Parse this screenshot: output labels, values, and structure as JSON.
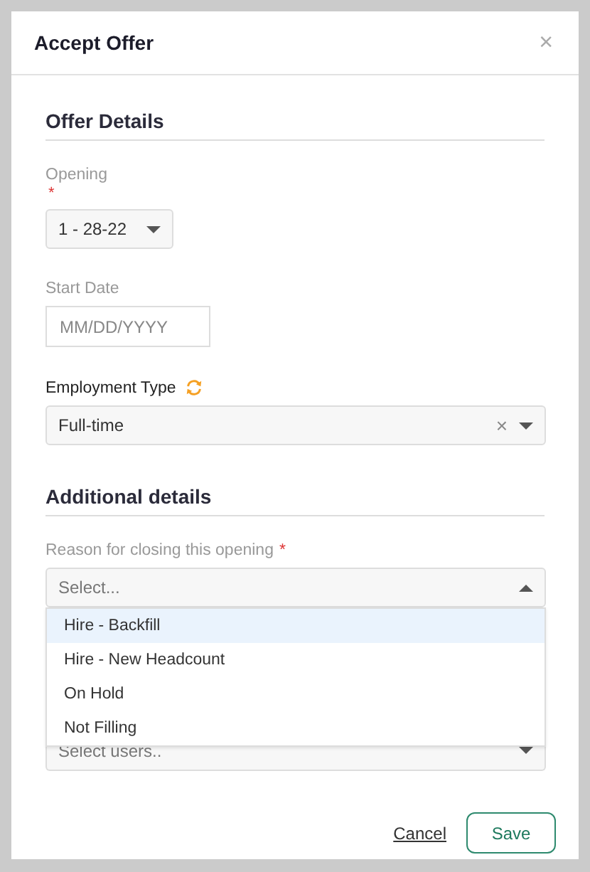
{
  "dialog": {
    "title": "Accept Offer",
    "close": "×"
  },
  "offer_details": {
    "heading": "Offer Details",
    "opening": {
      "label": "Opening",
      "required_mark": "*",
      "value": "1 - 28-22"
    },
    "start_date": {
      "label": "Start Date",
      "placeholder": "MM/DD/YYYY"
    },
    "employment_type": {
      "label": "Employment Type",
      "value": "Full-time",
      "clear": "×"
    }
  },
  "additional_details": {
    "heading": "Additional details",
    "reason": {
      "label": "Reason for closing this opening",
      "required_mark": "*",
      "placeholder": "Select...",
      "expanded": true,
      "options": [
        {
          "label": "Hire - Backfill",
          "selected": true
        },
        {
          "label": "Hire - New Headcount",
          "selected": false
        },
        {
          "label": "On Hold",
          "selected": false
        },
        {
          "label": "Not Filling",
          "selected": false
        }
      ]
    },
    "users": {
      "placeholder": "Select users.."
    }
  },
  "buttons": {
    "cancel": "Cancel",
    "save": "Save"
  }
}
